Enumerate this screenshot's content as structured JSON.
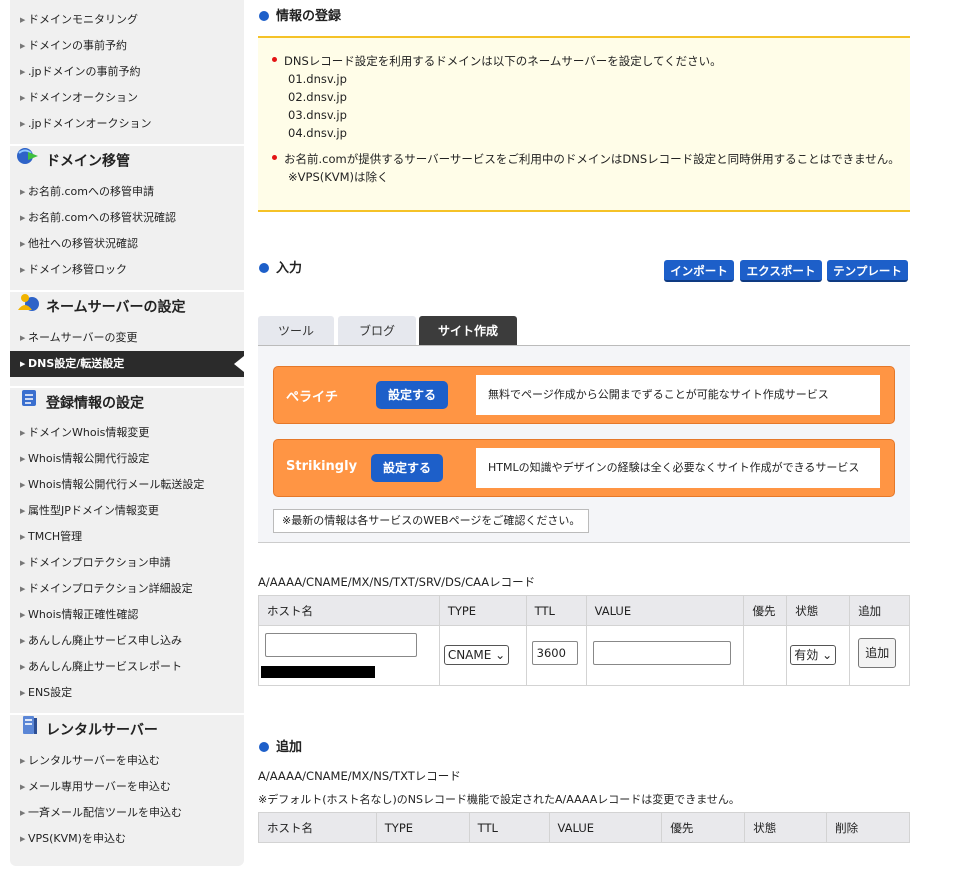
{
  "sidebar": {
    "items_top": [
      "ドメインモニタリング",
      "ドメインの事前予約",
      ".jpドメインの事前予約",
      "ドメインオークション",
      ".jpドメインオークション"
    ],
    "section_transfer": {
      "title": "ドメイン移管",
      "items": [
        "お名前.comへの移管申請",
        "お名前.comへの移管状況確認",
        "他社への移管状況確認",
        "ドメイン移管ロック"
      ]
    },
    "section_nameserver": {
      "title": "ネームサーバーの設定",
      "items": [
        "ネームサーバーの変更",
        "DNS設定/転送設定"
      ]
    },
    "section_registration": {
      "title": "登録情報の設定",
      "items": [
        "ドメインWhois情報変更",
        "Whois情報公開代行設定",
        "Whois情報公開代行メール転送設定",
        "属性型JPドメイン情報変更",
        "TMCH管理",
        "ドメインプロテクション申請",
        "ドメインプロテクション詳細設定",
        "Whois情報正確性確認",
        "あんしん廃止サービス申し込み",
        "あんしん廃止サービスレポート",
        "ENS設定"
      ]
    },
    "section_rental": {
      "title": "レンタルサーバー",
      "items": [
        "レンタルサーバーを申込む",
        "メール専用サーバーを申込む",
        "一斉メール配信ツールを申込む",
        "VPS(KVM)を申込む"
      ]
    }
  },
  "info": {
    "title": "情報の登録",
    "bullet1": "DNSレコード設定を利用するドメインは以下のネームサーバーを設定してください。",
    "nameservers": [
      "01.dnsv.jp",
      "02.dnsv.jp",
      "03.dnsv.jp",
      "04.dnsv.jp"
    ],
    "bullet2": "お名前.comが提供するサーバーサービスをご利用中のドメインはDNSレコード設定と同時併用することはできません。",
    "bullet2_note": "※VPS(KVM)は除く"
  },
  "input_section": {
    "title": "入力",
    "import_label": "インポート",
    "export_label": "エクスポート",
    "template_label": "テンプレート"
  },
  "tabs": [
    "ツール",
    "ブログ",
    "サイト作成"
  ],
  "promos": [
    {
      "name": "ペライチ",
      "button": "設定する",
      "desc": "無料でページ作成から公開までずることが可能なサイト作成サービス"
    },
    {
      "name": "Strikingly",
      "button": "設定する",
      "desc": "HTMLの知識やデザインの経験は全く必要なくサイト作成ができるサービス"
    }
  ],
  "promo_note": "※最新の情報は各サービスのWEBページをご確認ください。",
  "record_form": {
    "label": "A/AAAA/CNAME/MX/NS/TXT/SRV/DS/CAAレコード",
    "headers": [
      "ホスト名",
      "TYPE",
      "TTL",
      "VALUE",
      "優先",
      "状態",
      "追加"
    ],
    "host_value": "",
    "type_value": "CNAME",
    "ttl_value": "3600",
    "value_value": "",
    "status_value": "有効",
    "add_label": "追加"
  },
  "add_section": {
    "title": "追加",
    "label": "A/AAAA/CNAME/MX/NS/TXTレコード",
    "note": "※デフォルト(ホスト名なし)のNSレコード機能で設定されたA/AAAAレコードは変更できません。",
    "headers": [
      "ホスト名",
      "TYPE",
      "TTL",
      "VALUE",
      "優先",
      "状態",
      "削除"
    ]
  },
  "colors": {
    "accent": "#1d5fc9",
    "promo": "#ff9544",
    "info_border": "#f5c227",
    "alert": "#e31414"
  }
}
